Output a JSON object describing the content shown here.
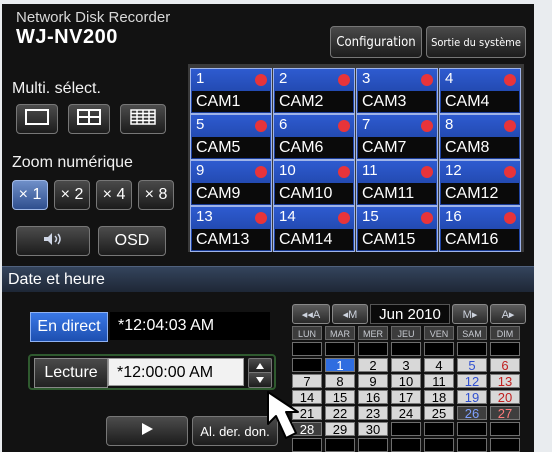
{
  "header": {
    "subtitle": "Network Disk Recorder",
    "model": "WJ-NV200"
  },
  "top_buttons": {
    "configuration": "Configuration",
    "system_exit": "Sortie du système"
  },
  "multi": {
    "label": "Multi. sélect.",
    "icons": [
      "single-screen-icon",
      "quad-split-icon",
      "sixteen-split-icon"
    ]
  },
  "zoom": {
    "label": "Zoom numérique",
    "options": [
      "× 1",
      "× 2",
      "× 4",
      "× 8"
    ],
    "selected": "× 1"
  },
  "audio_icon": "speaker-icon",
  "osd_label": "OSD",
  "cameras": [
    {
      "num": "1",
      "name": "CAM1"
    },
    {
      "num": "2",
      "name": "CAM2"
    },
    {
      "num": "3",
      "name": "CAM3"
    },
    {
      "num": "4",
      "name": "CAM4"
    },
    {
      "num": "5",
      "name": "CAM5"
    },
    {
      "num": "6",
      "name": "CAM6"
    },
    {
      "num": "7",
      "name": "CAM7"
    },
    {
      "num": "8",
      "name": "CAM8"
    },
    {
      "num": "9",
      "name": "CAM9"
    },
    {
      "num": "10",
      "name": "CAM10"
    },
    {
      "num": "11",
      "name": "CAM11"
    },
    {
      "num": "12",
      "name": "CAM12"
    },
    {
      "num": "13",
      "name": "CAM13"
    },
    {
      "num": "14",
      "name": "CAM14"
    },
    {
      "num": "15",
      "name": "CAM15"
    },
    {
      "num": "16",
      "name": "CAM16"
    }
  ],
  "datetime": {
    "header": "Date et heure",
    "live_label": "En direct",
    "live_time": "*12:04:03 AM",
    "playback_label": "Lecture",
    "playback_time": "*12:00:00 AM",
    "play_icon": "play-icon",
    "last_rec_label": "Al. der. don."
  },
  "calendar": {
    "nav": {
      "prev_year": "◂◂A",
      "prev_month": "◂M",
      "next_month": "M▸",
      "next_year": "A▸"
    },
    "month": "Jun 2010",
    "weekdays": [
      "LUN",
      "MAR",
      "MER",
      "JEU",
      "VEN",
      "SAM",
      "DIM"
    ],
    "weeks": [
      [
        "",
        "",
        "",
        "",
        "",
        "",
        ""
      ],
      [
        "",
        "1",
        "2",
        "3",
        "4",
        "5",
        "6"
      ],
      [
        "7",
        "8",
        "9",
        "10",
        "11",
        "12",
        "13"
      ],
      [
        "14",
        "15",
        "16",
        "17",
        "18",
        "19",
        "20"
      ],
      [
        "21",
        "22",
        "23",
        "24",
        "25",
        "26",
        "27"
      ],
      [
        "28",
        "29",
        "30",
        "",
        "",
        "",
        ""
      ],
      [
        "",
        "",
        "",
        "",
        "",
        "",
        ""
      ]
    ],
    "today": "1",
    "dark_days": [
      "26",
      "27",
      "28"
    ],
    "colors": {
      "saturday": "#3050d0",
      "sunday": "#c01f1f",
      "today": "#2f6de0"
    }
  }
}
